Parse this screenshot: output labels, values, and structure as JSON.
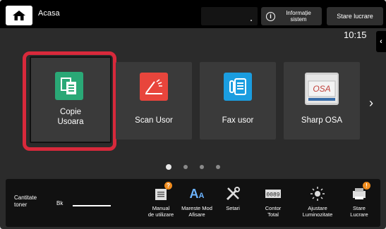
{
  "header": {
    "title": "Acasa",
    "info_button": "Informație\nsistem",
    "status_button": "Stare lucrare"
  },
  "clock": "10:15",
  "side_tab_icon": "chevron-left-icon",
  "tiles": [
    {
      "label_line1": "Copie",
      "label_line2": "Usoara",
      "icon": "copy-icon",
      "color": "#2aa876"
    },
    {
      "label": "Scan Usor",
      "icon": "scan-icon",
      "color": "#e8453c"
    },
    {
      "label": "Fax usor",
      "icon": "fax-icon",
      "color": "#1a9de0"
    },
    {
      "label": "Sharp OSA",
      "icon": "osa-icon",
      "color": "#c8c8c8"
    }
  ],
  "pager": {
    "pages": 4,
    "active": 1
  },
  "toner": {
    "label_line1": "Cantitate",
    "label_line2": "toner",
    "channel": "Bk"
  },
  "bottom_items": [
    {
      "label_line1": "Manual",
      "label_line2": "de utilizare",
      "icon": "manual-icon"
    },
    {
      "label_line1": "Mareste Mod",
      "label_line2": "Afisare",
      "icon": "font-size-icon"
    },
    {
      "label_line1": "Setari",
      "label_line2": "",
      "icon": "settings-tools-icon"
    },
    {
      "label_line1": "Contor",
      "label_line2": "Total",
      "icon": "counter-icon"
    },
    {
      "label_line1": "Ajustare",
      "label_line2": "Luminozitate",
      "icon": "brightness-icon"
    },
    {
      "label_line1": "Stare",
      "label_line2": "Lucrare",
      "icon": "job-status-icon"
    }
  ],
  "colors": {
    "highlight": "#d8293b",
    "badge": "#f08c1e",
    "accent_blue": "#1a9de0"
  }
}
